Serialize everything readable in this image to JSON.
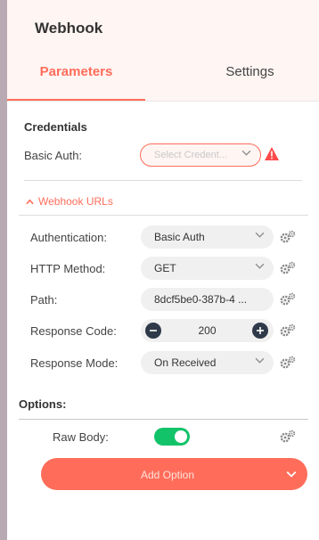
{
  "node": {
    "title": "Webhook"
  },
  "tabs": [
    {
      "label": "Parameters"
    },
    {
      "label": "Settings"
    }
  ],
  "credentials": {
    "section_title": "Credentials",
    "label": "Basic Auth:",
    "placeholder": "Select Credent..."
  },
  "webhook_urls": {
    "label": "Webhook URLs"
  },
  "fields": {
    "authentication": {
      "label": "Authentication:",
      "value": "Basic Auth"
    },
    "http_method": {
      "label": "HTTP Method:",
      "value": "GET"
    },
    "path": {
      "label": "Path:",
      "value": "8dcf5be0-387b-4 ..."
    },
    "response_code": {
      "label": "Response Code:",
      "value": "200"
    },
    "response_mode": {
      "label": "Response Mode:",
      "value": "On Received"
    }
  },
  "options": {
    "title": "Options:",
    "raw_body": {
      "label": "Raw Body:",
      "enabled": true
    },
    "add_option_label": "Add Option"
  },
  "colors": {
    "accent": "#ff6d5a",
    "toggle_on": "#13c36a",
    "header_bg": "#fff5f3"
  }
}
